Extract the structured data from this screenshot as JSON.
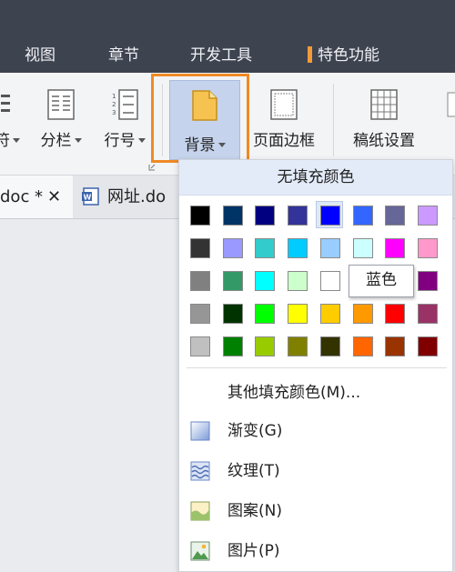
{
  "menubar": {
    "items": [
      "视图",
      "章节",
      "开发工具",
      "特色功能"
    ]
  },
  "ribbon": {
    "partial_label": "符",
    "columns_label": "分栏",
    "line_number_label": "行号",
    "background_label": "背景",
    "page_border_label": "页面边框",
    "manuscript_label": "稿纸设置"
  },
  "tabs": {
    "doc_tab": "doc *",
    "url_tab": "网址.do"
  },
  "dropdown": {
    "no_fill": "无填充颜色",
    "tooltip": "蓝色",
    "swatch_rows": [
      [
        "#000000",
        "#003366",
        "#000080",
        "#333399",
        "#0000ff",
        "#3366ff",
        "#666699",
        "#cc99ff"
      ],
      [
        "#333333",
        "#9999ff",
        "#33cccc",
        "#00ccff",
        "#99ccff",
        "#ccffff",
        "#ff00ff",
        "#ff99cc"
      ],
      [
        "#808080",
        "#339966",
        "#00ffff",
        "#ccffcc",
        "#ffffff",
        "#ffff99",
        "#800080",
        "#800080"
      ],
      [
        "#969696",
        "#003300",
        "#00ff00",
        "#ffff00",
        "#ffcc00",
        "#ff9900",
        "#ff0000",
        "#993366"
      ],
      [
        "#c0c0c0",
        "#008000",
        "#99cc00",
        "#808000",
        "#333300",
        "#ff6600",
        "#993300",
        "#800000"
      ]
    ],
    "selected_color": "#0000ff",
    "more_colors": "其他填充颜色(M)...",
    "items": [
      {
        "label": "渐变(G)",
        "icon": "gradient-icon"
      },
      {
        "label": "纹理(T)",
        "icon": "texture-icon"
      },
      {
        "label": "图案(N)",
        "icon": "pattern-icon"
      },
      {
        "label": "图片(P)",
        "icon": "picture-icon"
      }
    ]
  },
  "colors": {
    "highlight": "#f08a24",
    "menubar_bg": "#3e4350",
    "selected_button_bg": "#c5d3ec"
  }
}
